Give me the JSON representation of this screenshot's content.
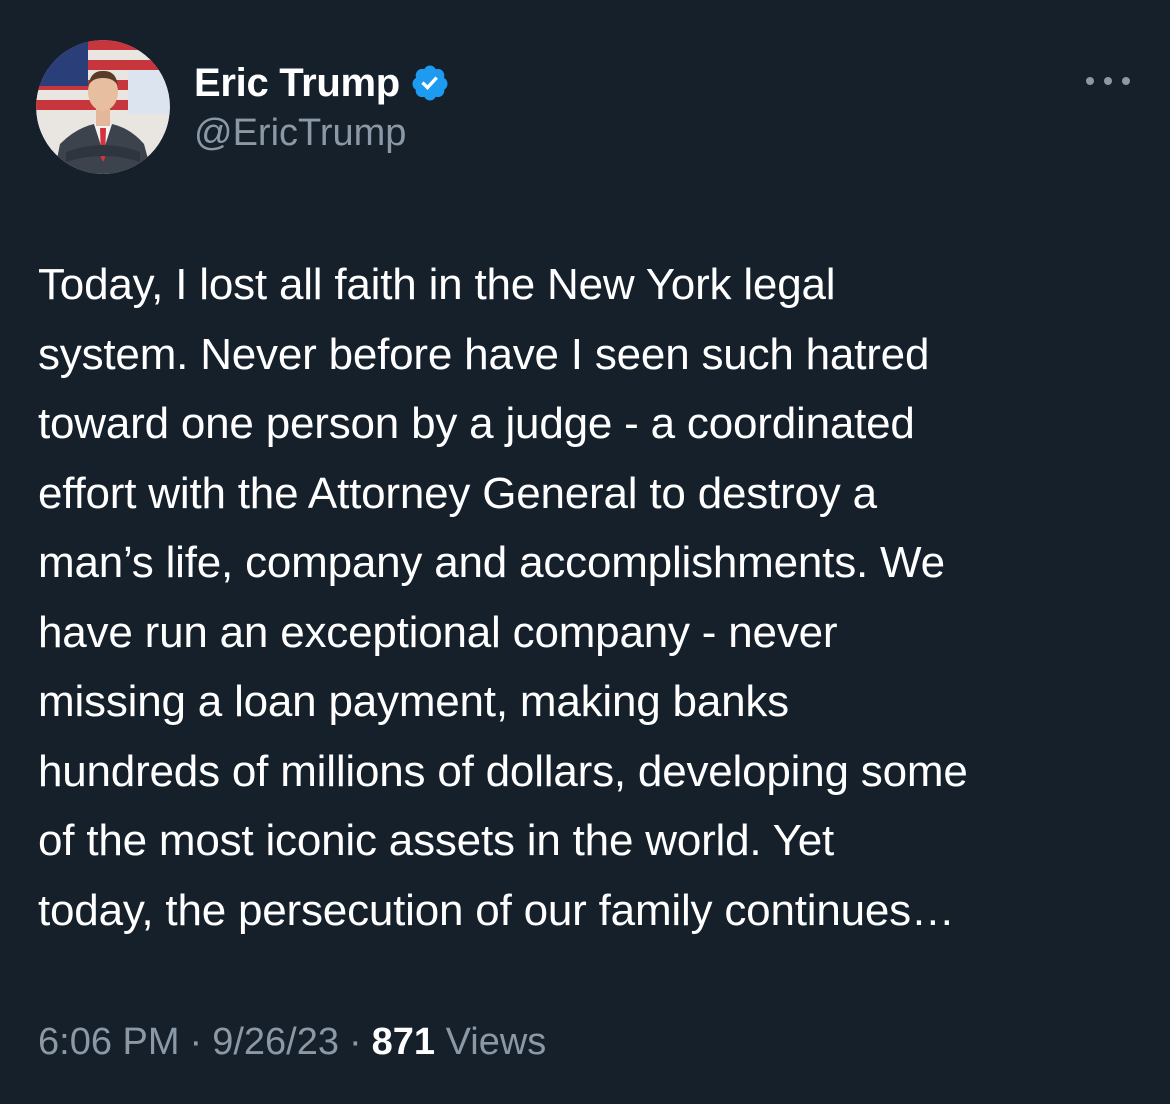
{
  "author": {
    "display_name": "Eric Trump",
    "handle": "@EricTrump",
    "verified": true,
    "avatar_icon": "profile-photo"
  },
  "menu": {
    "icon": "more-options-icon"
  },
  "tweet": {
    "lines": [
      "Today, I lost all faith in the New York legal",
      "system. Never before have I seen such hatred",
      "toward one person by a judge - a coordinated",
      "effort with the Attorney General to destroy a",
      "man’s life, company and accomplishments. We",
      "have run an exceptional company - never",
      "missing a loan payment, making banks",
      "hundreds of millions of dollars, developing some",
      "of the most iconic assets in the world. Yet",
      "today, the persecution of our family continues…"
    ]
  },
  "meta": {
    "time": "6:06 PM",
    "separator": "·",
    "date": "9/26/23",
    "views_count": "871",
    "views_label": "Views"
  },
  "colors": {
    "background": "#15202b",
    "text_primary": "#ffffff",
    "text_secondary": "#8b98a5",
    "verified_badge": "#1d9bf0"
  }
}
